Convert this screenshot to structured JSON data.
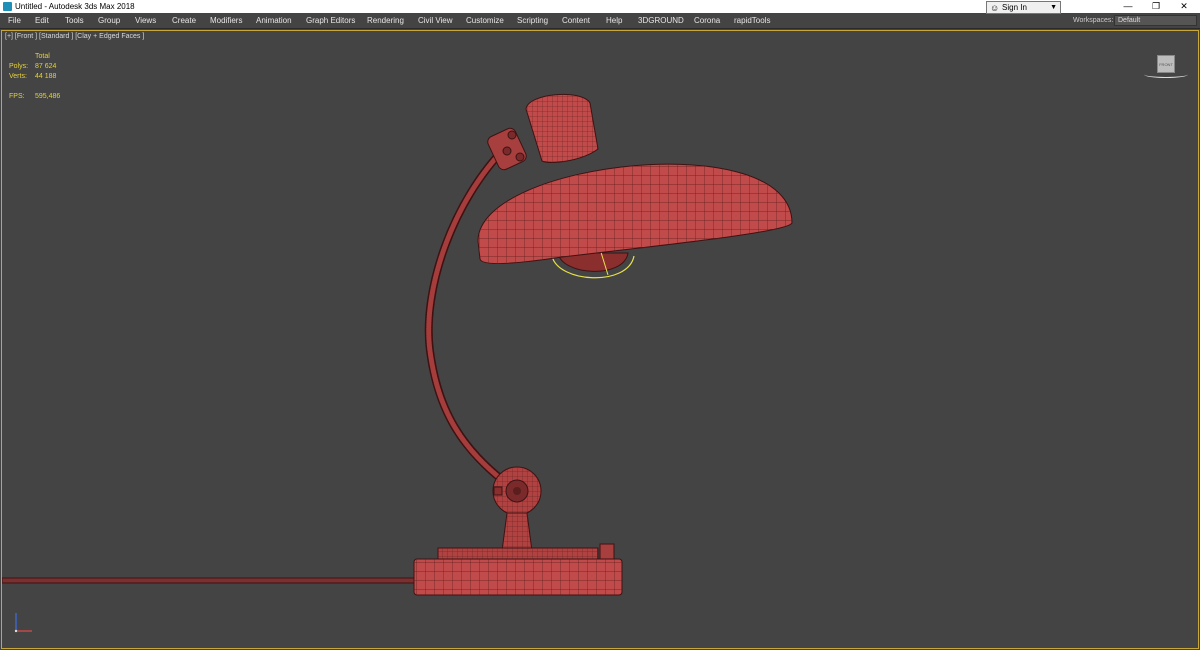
{
  "window": {
    "title": "Untitled - Autodesk 3ds Max 2018",
    "minimize_glyph": "—",
    "restore_glyph": "❐",
    "close_glyph": "✕"
  },
  "menu": {
    "items": [
      "File",
      "Edit",
      "Tools",
      "Group",
      "Views",
      "Create",
      "Modifiers",
      "Animation",
      "Graph Editors",
      "Rendering",
      "Civil View",
      "Customize",
      "Scripting",
      "Content",
      "Help",
      "3DGROUND",
      "Corona",
      "rapidTools"
    ]
  },
  "account": {
    "signin_label": "Sign In",
    "user_icon": "user-icon",
    "caret_icon": "caret-down-icon"
  },
  "workspaces": {
    "label": "Workspaces:",
    "value": "Default"
  },
  "viewport": {
    "label": "[+] [Front ] [Standard ] [Clay + Edged Faces ]",
    "stats": {
      "header": "Total",
      "polys_label": "Polys:",
      "polys_value": "87 624",
      "verts_label": "Verts:",
      "verts_value": "44 188",
      "fps_label": "FPS:",
      "fps_value": "595,486"
    },
    "viewcube_label": "FRONT",
    "colors": {
      "background": "#444444",
      "frame": "#c8a63a",
      "model": "#c14a4a",
      "wire": "#5c1d1d",
      "selection": "#e6e14a",
      "stats_text": "#e6d23a"
    }
  }
}
